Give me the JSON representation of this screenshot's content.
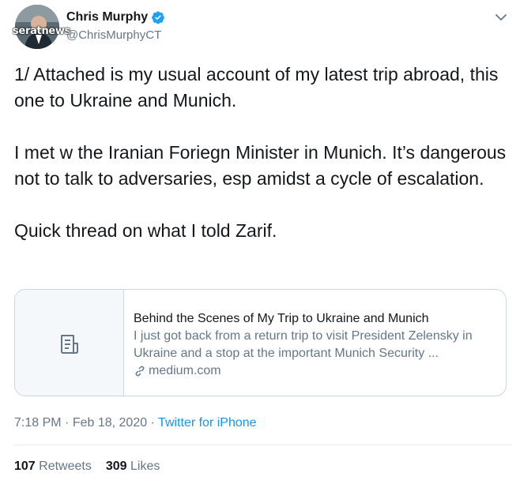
{
  "header": {
    "display_name": "Chris Murphy",
    "handle": "@ChrisMurphyCT",
    "watermark": "seratnews"
  },
  "tweet": {
    "paragraphs": [
      "1/ Attached is my usual account of my latest trip abroad, this one to Ukraine and Munich.",
      "I met w the Iranian Foriegn Minister in Munich. It’s dangerous not to talk to adversaries, esp amidst a cycle of escalation.",
      "Quick thread on what I told Zarif."
    ]
  },
  "card": {
    "title": "Behind the Scenes of My Trip to Ukraine and Munich",
    "description": "I just got back from a return trip to visit President Zelensky in Ukraine and a stop at the important Munich Security ...",
    "domain": "medium.com",
    "thumb_icon": "document-icon"
  },
  "meta": {
    "time": "7:18 PM",
    "separator": " · ",
    "date": "Feb 18, 2020",
    "source": "Twitter for iPhone"
  },
  "stats": {
    "retweets_count": "107",
    "retweets_label": "Retweets",
    "likes_count": "309",
    "likes_label": "Likes"
  },
  "colors": {
    "accent": "#1b95e0",
    "secondary_text": "#657786",
    "border": "#ccd6dd"
  }
}
